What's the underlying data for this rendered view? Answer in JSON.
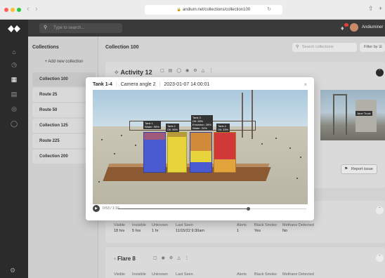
{
  "browser": {
    "url": "andium.net/collections/collection100"
  },
  "topbar": {
    "search_placeholder": "Type to search...",
    "user_name": "Andiuminer"
  },
  "collections": {
    "title": "Collections",
    "add_label": "+ Add new collection",
    "items": [
      {
        "label": "Collection 100",
        "selected": true
      },
      {
        "label": "Route 25"
      },
      {
        "label": "Route 50"
      },
      {
        "label": "Collection 125"
      },
      {
        "label": "Route 225"
      },
      {
        "label": "Collection 200"
      }
    ]
  },
  "main": {
    "title": "Collection 100",
    "search_placeholder": "Search collections",
    "filter_label": "Filter by ☰",
    "activity": {
      "title": "Activity 12",
      "report_label": "Report issue",
      "image_tag": "Jane Truck"
    },
    "stats_row": {
      "headers": [
        "Visible",
        "Invisible",
        "Unknown",
        "Last Seen",
        "Alerts",
        "Black Smoke",
        "Methane Detected"
      ],
      "values": [
        "18 hrs",
        "5 hrs",
        "1 hr",
        "11/15/22 9:30am",
        "1",
        "Yes",
        "No"
      ]
    },
    "flare": {
      "title": "Flare 8",
      "headers": [
        "Visible",
        "Invisible",
        "Unknown",
        "Last Seen",
        "Alerts",
        "Black Smoke",
        "Methane Detected"
      ]
    }
  },
  "modal": {
    "title": "Tank 1-4",
    "camera": "Camera angle 2",
    "timestamp": "2023-01-07 14:00:01",
    "time_display": "0:53 / 1:10",
    "progress": 0.69,
    "tank_labels": [
      "Tank 1\nWater: 99%",
      "Tank 2\nOil: 96%",
      "Tank 3\nOil: 28%\nEmulsion: 28%\nWater: 24%",
      "Tank 4\nOil: 33%"
    ]
  },
  "colors": {
    "tank_blue": "#4a5ad0",
    "tank_yellow": "#e6d43a",
    "tank_orange": "#e2a43a",
    "tank_red": "#d0383a",
    "notification": "#e2403c"
  },
  "icons": [
    "app-logo-icon",
    "home-icon",
    "clock-icon",
    "grid-icon",
    "chart-icon",
    "alert-icon",
    "shield-icon",
    "settings-icon",
    "search-icon",
    "bell-icon",
    "close-icon",
    "play-icon",
    "chevron-down-icon",
    "chevron-up-icon",
    "more-icon",
    "flag-icon"
  ]
}
